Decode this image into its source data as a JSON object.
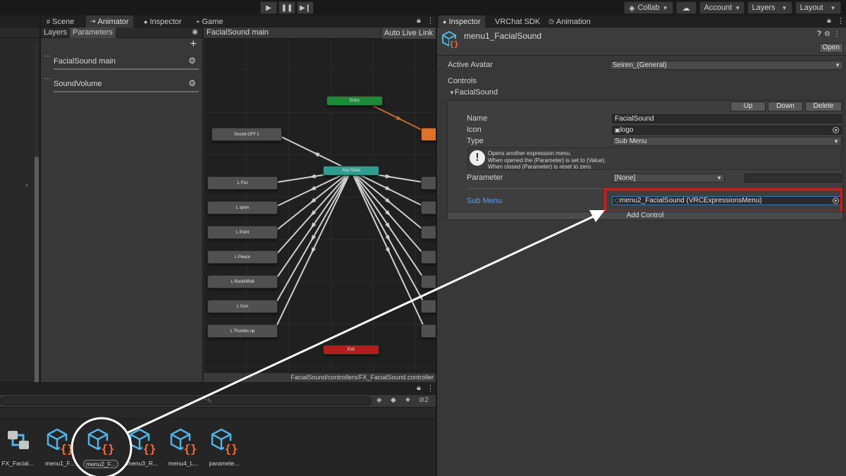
{
  "toolbar": {
    "play_icons": [
      "play-icon",
      "pause-icon",
      "step-icon"
    ],
    "collab_label": "Collab",
    "cloud_icon": "cloud-icon",
    "account_label": "Account",
    "layers_label": "Layers",
    "layout_label": "Layout"
  },
  "animator_window": {
    "tabs": [
      {
        "label": "Scene",
        "icon": "grid-icon"
      },
      {
        "label": "Animator",
        "icon": "animator-icon"
      },
      {
        "label": "Inspector",
        "icon": "info-icon"
      },
      {
        "label": "Game",
        "icon": "gamepad-icon"
      }
    ],
    "subtabs": [
      "Layers",
      "Parameters"
    ],
    "parameters": [
      {
        "name": "FacialSound main"
      },
      {
        "name": "SoundVolume"
      }
    ],
    "graph": {
      "breadcrumb": "FacialSound main",
      "live_link_label": "Auto Live Link",
      "footer_path": "FacialSound/controllers/FX_FacialSound.controller",
      "entry_label": "Entry",
      "any_state_label": "Any State",
      "exit_label": "Exit",
      "left_states": [
        "Sound OFF L",
        "L Fist",
        "L open",
        "L Point",
        "L Peace",
        "L RockNRoll",
        "L Gun",
        "L Thumbs up"
      ]
    }
  },
  "inspector_window": {
    "tabs": [
      {
        "label": "Inspector",
        "icon": "info-icon"
      },
      {
        "label": "VRChat SDK",
        "icon": ""
      },
      {
        "label": "Animation",
        "icon": "clock-icon"
      }
    ],
    "asset_title": "menu1_FacialSound",
    "open_label": "Open",
    "active_avatar_label": "Active Avatar",
    "active_avatar_value": "Seiren_(General)",
    "controls_label": "Controls",
    "control_foldout": "FacialSound",
    "up_label": "Up",
    "down_label": "Down",
    "delete_label": "Delete",
    "name_label": "Name",
    "name_value": "FacialSound",
    "icon_label": "Icon",
    "icon_value": "logo",
    "type_label": "Type",
    "type_value": "Sub Menu",
    "help_text": "Opens another expression menu.\nWhen opened the (Parameter) is set to (Value).\nWhen closed (Parameter) is reset to zero.",
    "parameter_label": "Parameter",
    "parameter_value": "[None]",
    "submenu_label": "Sub Menu",
    "submenu_value": "menu2_FacialSound (VRCExpressionsMenu)",
    "add_control_label": "Add Control",
    "highlight_color": "#e81212",
    "link_color": "#5b9cf0"
  },
  "project_window": {
    "hidden_count": "2",
    "assets": [
      {
        "label": "FX_Facial...",
        "icon": "animator-controller-icon"
      },
      {
        "label": "menu1_F...",
        "icon": "expressions-menu-icon"
      },
      {
        "label": "menu2_F...",
        "icon": "expressions-menu-icon"
      },
      {
        "label": "menu3_R...",
        "icon": "expressions-menu-icon"
      },
      {
        "label": "menu4_L...",
        "icon": "expressions-menu-icon"
      },
      {
        "label": "paramete...",
        "icon": "expressions-menu-icon"
      }
    ]
  },
  "annotation": {
    "circle_color": "#ffffff",
    "arrow_color": "#ffffff"
  }
}
